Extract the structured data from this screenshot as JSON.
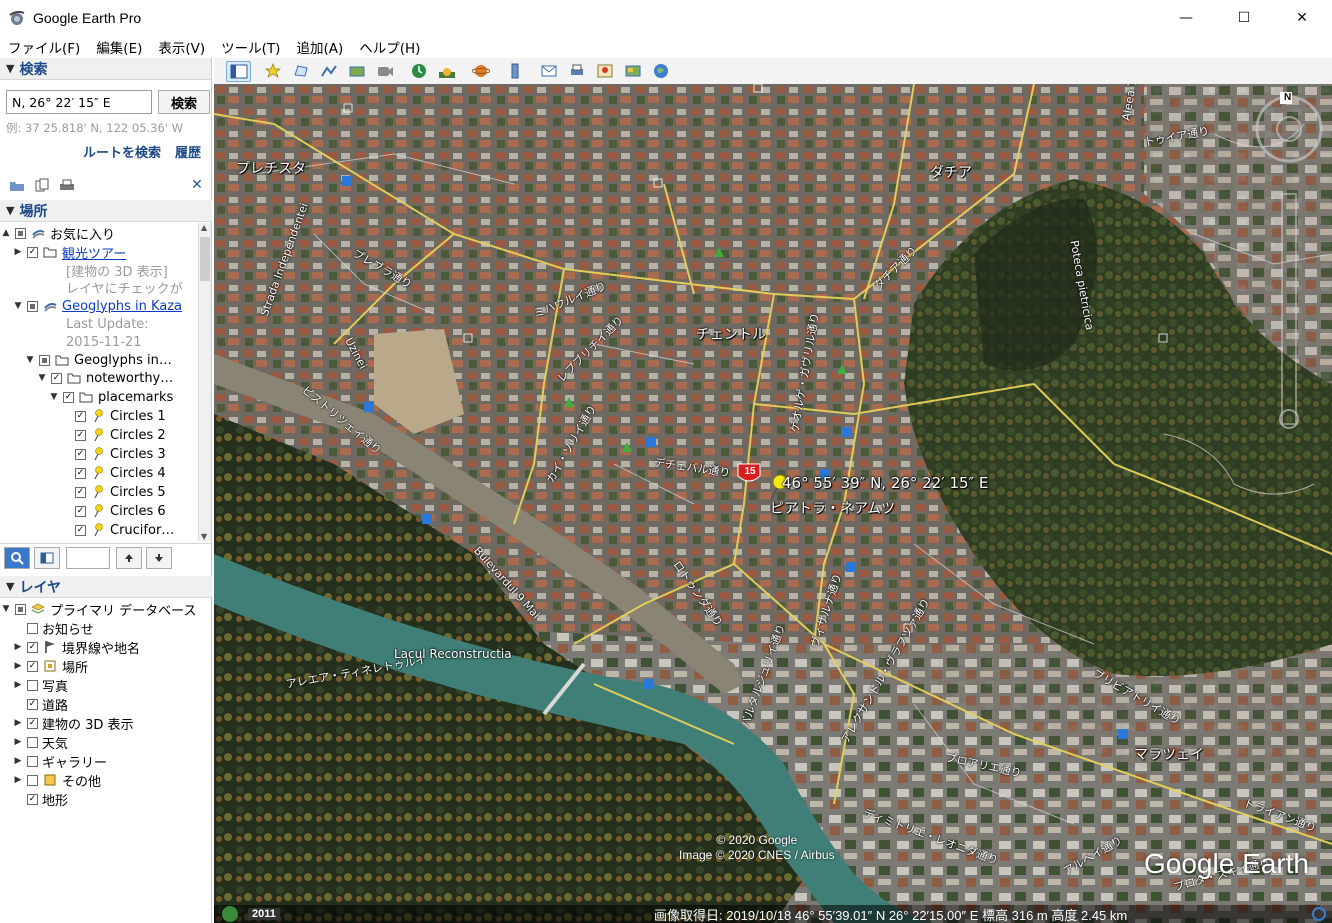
{
  "window": {
    "title": "Google Earth Pro",
    "minimize": "—",
    "maximize": "☐",
    "close": "✕"
  },
  "menu": [
    "ファイル(F)",
    "編集(E)",
    "表示(V)",
    "ツール(T)",
    "追加(A)",
    "ヘルプ(H)"
  ],
  "search": {
    "header": "検索",
    "input_value": "N, 26° 22′ 15″ E",
    "button": "検索",
    "example": "例: 37 25.818' N, 122 05.36' W",
    "route_link": "ルートを検索",
    "history_link": "履歴"
  },
  "places": {
    "header": "場所",
    "items": {
      "favorites": "お気に入り",
      "tour": "観光ツアー",
      "tour_desc_1": "[建物の 3D 表示]",
      "tour_desc_2": "レイヤにチェックが",
      "geoglyphs_link": "Geoglyphs in Kaza",
      "last_update": "Last Update:",
      "last_update_date": "2015-11-21",
      "geoglyphs_folder": "Geoglyphs in…",
      "noteworthy": "noteworthy…",
      "placemarks": "placemarks",
      "circles": [
        "Circles 1",
        "Circles 2",
        "Circles 3",
        "Circles 4",
        "Circles 5",
        "Circles 6"
      ],
      "crucifor": "Crucifor…"
    }
  },
  "layers": {
    "header": "レイヤ",
    "primary": "プライマリ データベース",
    "items": [
      "お知らせ",
      "境界線や地名",
      "場所",
      "写真",
      "道路",
      "建物の 3D 表示",
      "天気",
      "ギャラリー",
      "その他",
      "地形"
    ],
    "checked": [
      false,
      true,
      true,
      false,
      true,
      true,
      false,
      false,
      false,
      true
    ],
    "expandable": [
      false,
      true,
      true,
      true,
      false,
      true,
      true,
      true,
      true,
      false
    ]
  },
  "map": {
    "place_labels": [
      "プレチスタ",
      "ダチア",
      "チェントル",
      "ピアトラ・ネアムツ",
      "マラツェイ"
    ],
    "street_labels": [
      "Strada Independentei",
      "プレブラ通り",
      "Uzinei",
      "ミハウルイ通り",
      "レプブリチイ通り",
      "ダチア通り",
      "ゲオルゲ・ガヴリル通り",
      "ピストリツェイ通り",
      "カイ・ソリイ通り",
      "デチェバル通り",
      "Bulevardul 9 Mai",
      "ロトゥンダ通り",
      "ヴィサルナ通り",
      "アレエア・ティネレトゥルイ",
      "バルタルジュリイ通り",
      "アレクサンドル・ヴラフツァ通り",
      "プロアリエ通り",
      "ブリビアトリイ通り",
      "トライアン通り",
      "ディミトリエ・レオニダ通り",
      "Poteca pietricica",
      "Aleea Tineretului",
      "Lacul Reconstructia",
      "アルベイ通り",
      "プロタ・スキイ通り",
      "トゥイア通り"
    ],
    "coordinates": "46° 55′ 39″ N, 26° 22′ 15″ E",
    "route_shield": "15",
    "copyright_1": "© 2020 Google",
    "copyright_2": "Image © 2020 CNES / Airbus",
    "logo": "Google Earth",
    "year": "2011",
    "status": "画像取得日: 2019/10/18    46° 55′39.01″ N    26° 22′15.00″ E  標高   316 m       高度   2.45 km",
    "compass_n": "N"
  },
  "colors": {
    "accent": "#1c4a87",
    "link": "#0b3dbf",
    "river": "#3f7f78",
    "road": "#e8d25a"
  }
}
